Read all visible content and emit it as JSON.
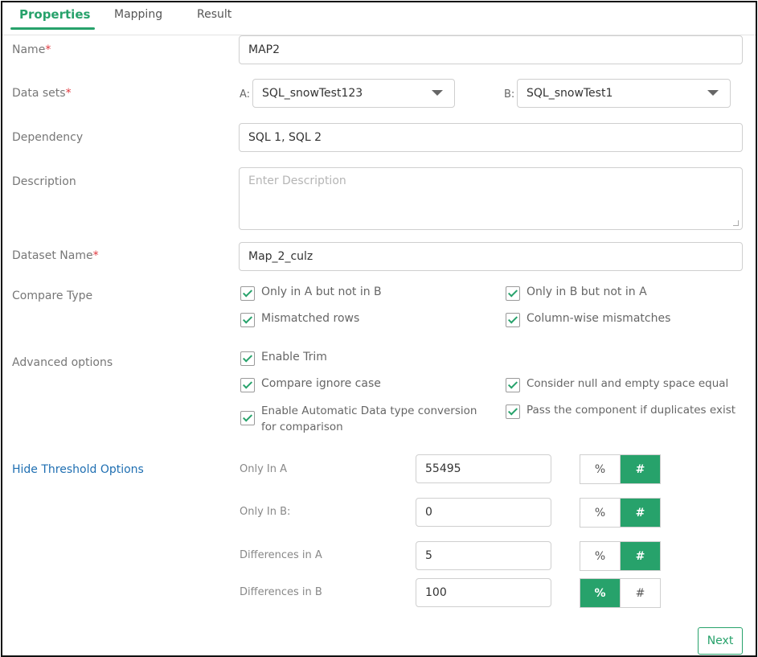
{
  "tabs": [
    {
      "label": "Properties",
      "active": true
    },
    {
      "label": "Mapping",
      "active": false
    },
    {
      "label": "Result",
      "active": false
    }
  ],
  "form": {
    "name": {
      "label": "Name",
      "required_mark": "*",
      "value": "MAP2"
    },
    "datasets": {
      "label": "Data sets",
      "required_mark": "*",
      "a_prefix": "A:",
      "a_value": "SQL_snowTest123",
      "b_prefix": "B:",
      "b_value": "SQL_snowTest1"
    },
    "dependency": {
      "label": "Dependency",
      "value": "SQL 1, SQL 2"
    },
    "description": {
      "label": "Description",
      "placeholder": "Enter Description",
      "value": ""
    },
    "dataset_name": {
      "label": "Dataset Name",
      "required_mark": "*",
      "value": "Map_2_culz"
    },
    "compare_type": {
      "label": "Compare Type",
      "options": [
        {
          "label": "Only in A but not in B",
          "checked": true
        },
        {
          "label": "Only in B but not in A",
          "checked": true
        },
        {
          "label": "Mismatched rows",
          "checked": true
        },
        {
          "label": "Column-wise mismatches",
          "checked": true
        }
      ]
    },
    "advanced": {
      "label": "Advanced options",
      "options": [
        {
          "label": "Enable Trim",
          "checked": true
        },
        {
          "label": "Compare ignore case",
          "checked": true
        },
        {
          "label": "Consider null and empty space equal",
          "checked": true
        },
        {
          "label_line1": "Enable Automatic Data type conversion",
          "label_line2": "for comparison",
          "checked": true
        },
        {
          "label": "Pass the component if duplicates exist",
          "checked": true
        }
      ]
    }
  },
  "threshold": {
    "link_label": "Hide Threshold Options",
    "rows": [
      {
        "label": "Only In A",
        "value": "55495",
        "percent_label": "%",
        "hash_label": "#",
        "selected": "#"
      },
      {
        "label": "Only In B:",
        "value": "0",
        "percent_label": "%",
        "hash_label": "#",
        "selected": "#"
      },
      {
        "label": "Differences in A",
        "value": "5",
        "percent_label": "%",
        "hash_label": "#",
        "selected": "#"
      },
      {
        "label": "Differences in B",
        "value": "100",
        "percent_label": "%",
        "hash_label": "#",
        "selected": "%"
      }
    ]
  },
  "footer": {
    "next_label": "Next"
  },
  "colors": {
    "accent": "#27a26b",
    "link": "#1f6fb2",
    "required": "#e0383e"
  }
}
